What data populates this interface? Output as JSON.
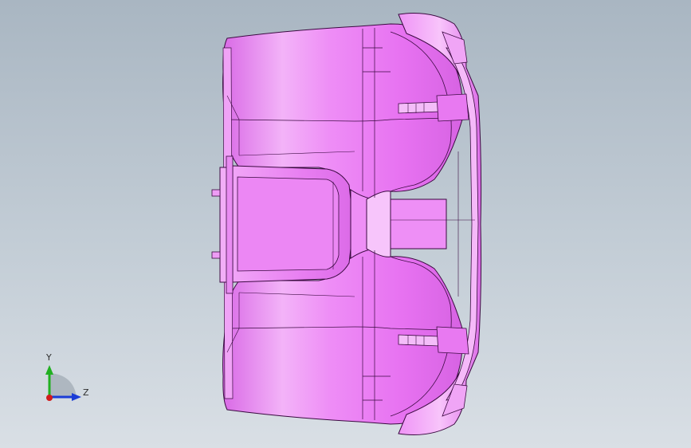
{
  "viewport": {
    "background_top": "#a9b6c2",
    "background_bottom": "#d9dfe5",
    "part_color": "#e57df0",
    "part_highlight": "#f6c8fa",
    "edge_color": "#3a0a40"
  },
  "triad": {
    "y_label": "Y",
    "z_label": "Z",
    "y_color": "#21b021",
    "z_color": "#1b3cd6",
    "x_color": "#d21b1b"
  }
}
